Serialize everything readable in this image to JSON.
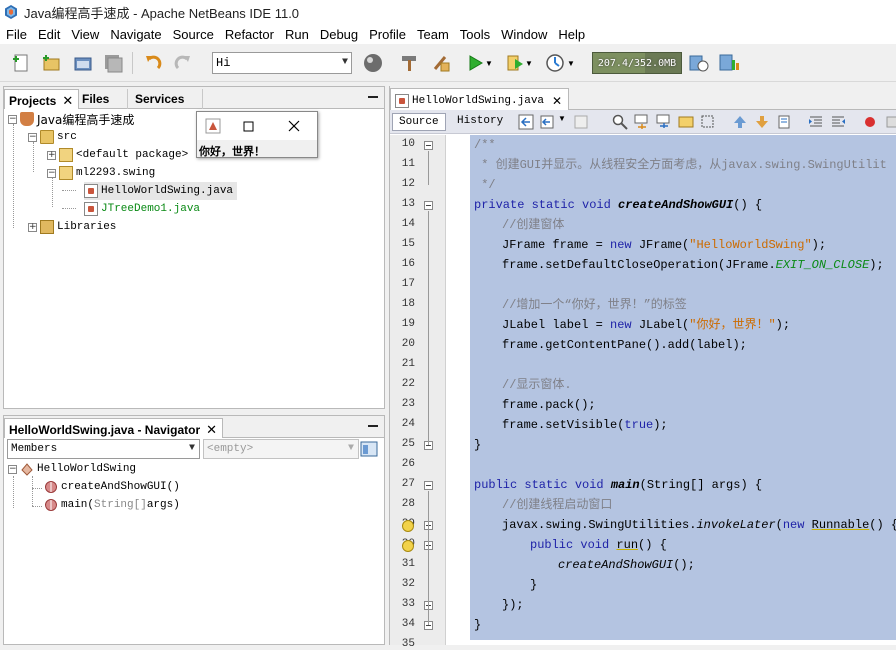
{
  "window": {
    "title": "Java编程高手速成 - Apache NetBeans IDE 11.0"
  },
  "menu": [
    "File",
    "Edit",
    "View",
    "Navigate",
    "Source",
    "Refactor",
    "Run",
    "Debug",
    "Profile",
    "Team",
    "Tools",
    "Window",
    "Help"
  ],
  "toolbar": {
    "config_value": "Hi",
    "memory": "207.4/352.0MB",
    "memory_fraction": 0.59
  },
  "projects_panel": {
    "tabs": [
      "Projects",
      "Files",
      "Services"
    ],
    "close_glyph": "✕",
    "minimize_glyph": "▁",
    "tree": {
      "project": "Java编程高手速成",
      "src": "src",
      "default_package": "<default package>",
      "package": "ml2293.swing",
      "file1": "HelloWorldSwing.java",
      "file2": "JTreeDemo1.java",
      "libraries": "Libraries"
    }
  },
  "popup": {
    "label": "你好，世界！"
  },
  "navigator": {
    "title": "HelloWorldSwing.java - Navigator",
    "members": "Members",
    "filter": "<empty>",
    "class": "HelloWorldSwing",
    "method1": "createAndShowGUI()",
    "method2_name": "main(",
    "method2_type": "String[]",
    "method2_rest": " args)"
  },
  "editor": {
    "tab": "HelloWorldSwing.java",
    "source_tab": "Source",
    "history_tab": "History",
    "line_numbers": [
      "10",
      "11",
      "12",
      "13",
      "14",
      "15",
      "16",
      "17",
      "18",
      "19",
      "20",
      "21",
      "22",
      "23",
      "24",
      "25",
      "26",
      "27",
      "28",
      "29",
      "30",
      "31",
      "32",
      "33",
      "34",
      "35"
    ],
    "code": {
      "l10": "/**",
      "l11": " * 创建GUI并显示。从线程安全方面考虑，从javax.swing.SwingUtilit",
      "l12": " */",
      "l13_kw": "private static void ",
      "l13_name": "createAndShowGUI",
      "l13_rest": "() {",
      "l14": "//创建窗体",
      "l15_a": "JFrame frame = ",
      "l15_kw": "new",
      "l15_b": " JFrame(",
      "l15_str": "\"HelloWorldSwing\"",
      "l15_c": ");",
      "l16_a": "frame.setDefaultCloseOperation(JFrame.",
      "l16_fld": "EXIT_ON_CLOSE",
      "l16_b": ");",
      "l18": "//增加一个“你好，世界！”的标签",
      "l19_a": "JLabel label = ",
      "l19_kw": "new",
      "l19_b": " JLabel(",
      "l19_str": "\"你好，世界！\"",
      "l19_c": ");",
      "l20": "frame.getContentPane().add(label);",
      "l22": "//显示窗体.",
      "l23": "frame.pack();",
      "l24_a": "frame.setVisible(",
      "l24_kw": "true",
      "l24_b": ");",
      "l25": "}",
      "l27_kw": "public static void ",
      "l27_name": "main",
      "l27_rest": "(String[] args) {",
      "l28": "//创建线程启动窗口",
      "l29_a": "javax.swing.SwingUtilities.",
      "l29_it": "invokeLater",
      "l29_b": "(",
      "l29_kw": "new",
      "l29_c": " ",
      "l29_ul": "Runnable",
      "l29_d": "() {",
      "l30_kw": "public void ",
      "l30_ul": "run",
      "l30_rest": "() {",
      "l31": "createAndShowGUI",
      "l31_rest": "();",
      "l32": "}",
      "l33": "});",
      "l34": "}"
    }
  }
}
